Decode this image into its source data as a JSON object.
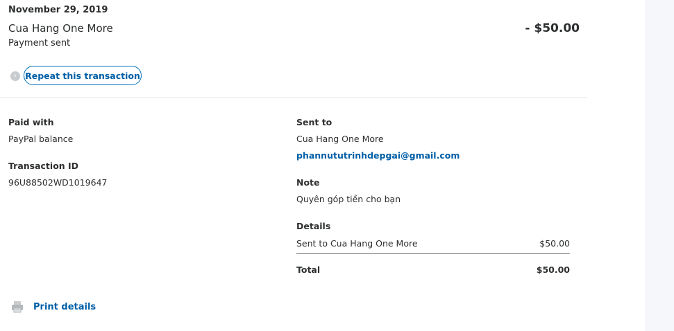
{
  "header": {
    "date": "November 29, 2019",
    "merchant": "Cua Hang One More",
    "status": "Payment sent",
    "amount": "- $50.00",
    "repeat_label": "Repeat this transaction"
  },
  "left": {
    "paid_with_label": "Paid with",
    "paid_with_value": "PayPal balance",
    "transaction_id_label": "Transaction ID",
    "transaction_id_value": "96U88502WD1019647"
  },
  "right": {
    "sent_to_label": "Sent to",
    "sent_to_name": "Cua Hang One More",
    "sent_to_email": "phannututrinhdepgai@gmail.com",
    "note_label": "Note",
    "note_value": "Quyên góp tiền cho bạn",
    "details_label": "Details",
    "details_item": "Sent to Cua Hang One More",
    "details_item_amount": "$50.00",
    "total_label": "Total",
    "total_amount": "$50.00"
  },
  "footer": {
    "print_label": "Print details"
  },
  "icons": {
    "repeat": "repeat-icon",
    "print": "printer-icon"
  },
  "colors": {
    "link": "#005ea6",
    "text": "#2c2e2f",
    "gutter": "#f5f7fa"
  }
}
